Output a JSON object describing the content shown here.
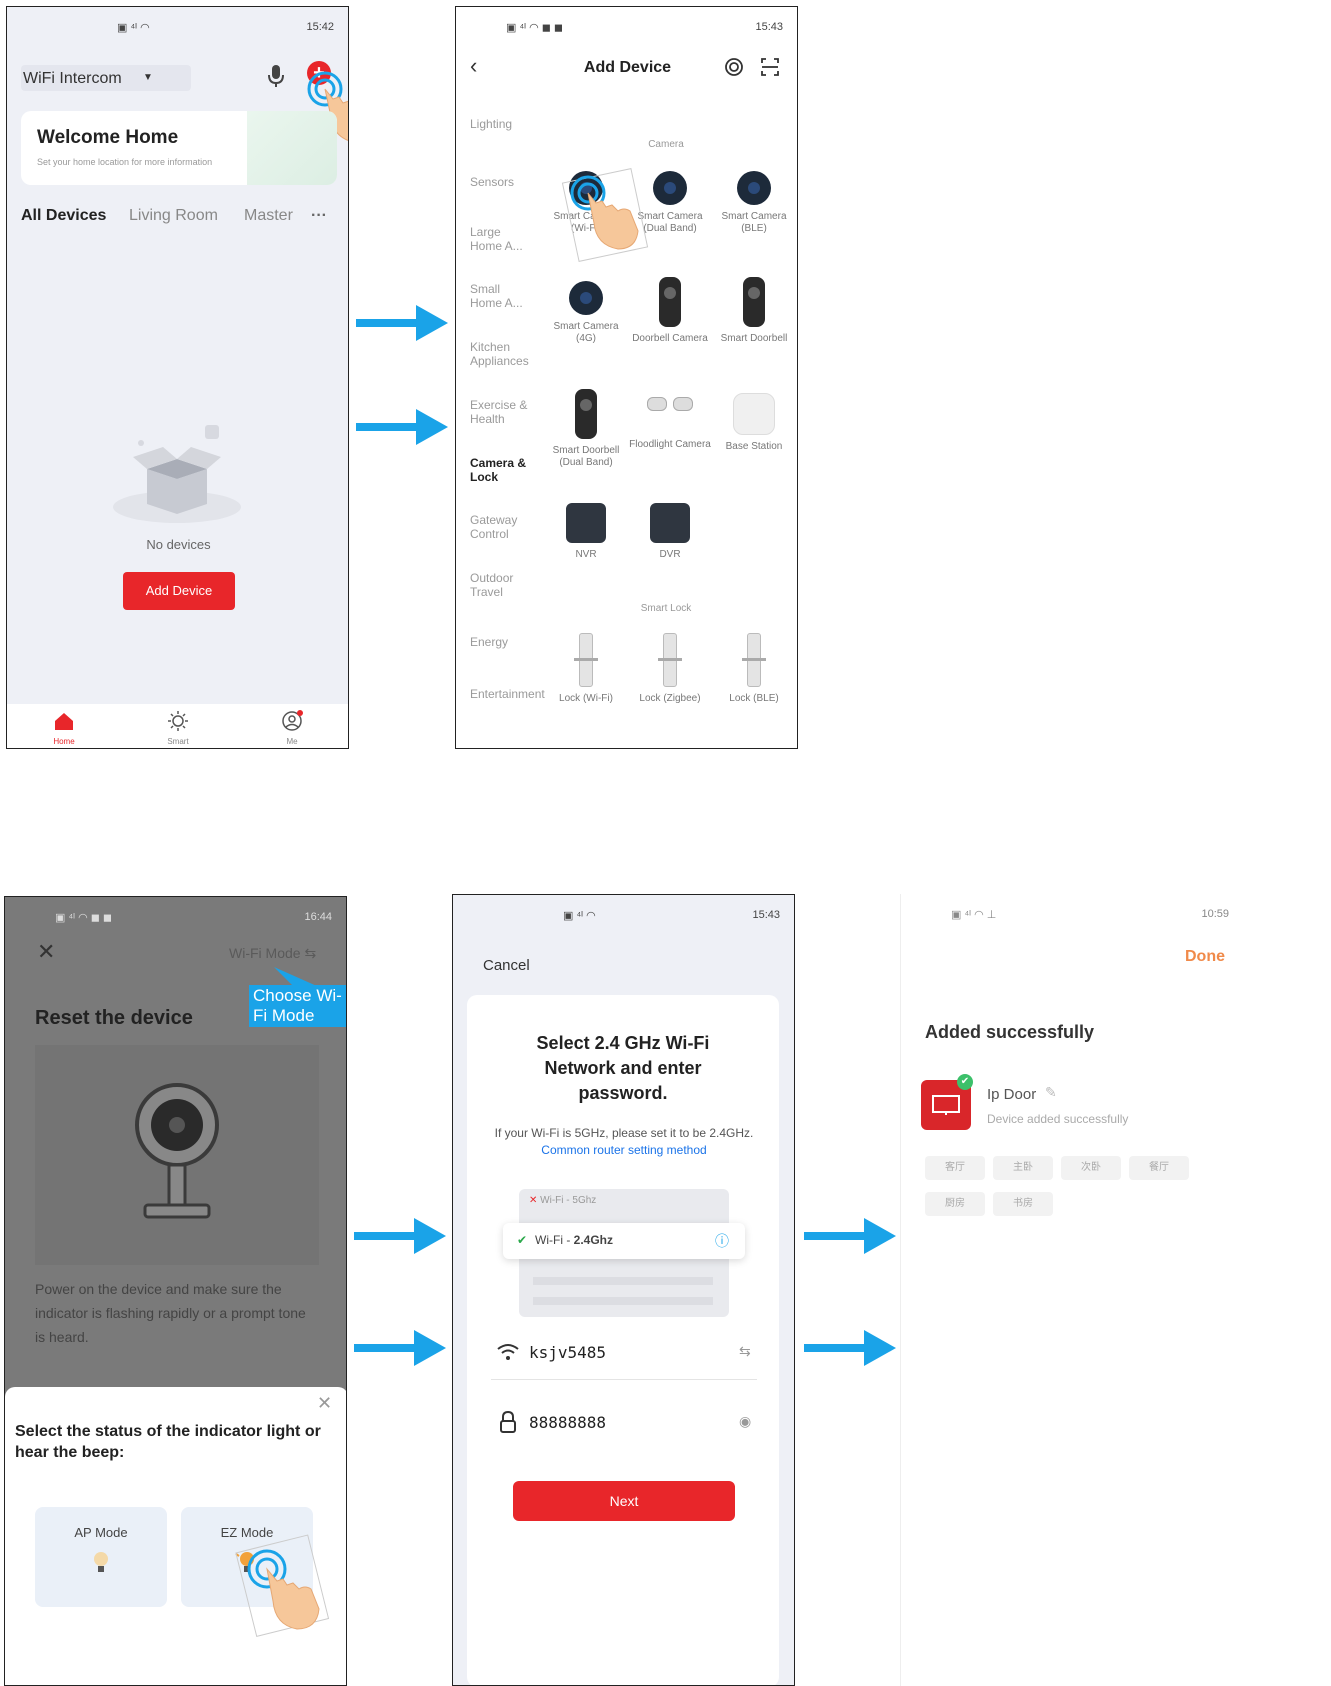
{
  "colors": {
    "accent_red": "#e8262a",
    "arrow_blue": "#1aa3e8",
    "link_blue": "#1a73e8"
  },
  "screen1": {
    "status_right": "15:42",
    "home_name": "WiFi Intercom",
    "welcome_title": "Welcome Home",
    "welcome_subtitle": "Set your home location for more information",
    "tabs": [
      "All Devices",
      "Living Room",
      "Master"
    ],
    "more": "···",
    "empty_text": "No devices",
    "add_button": "Add Device",
    "nav": [
      {
        "label": "Home",
        "icon": "home-icon"
      },
      {
        "label": "Smart",
        "icon": "sun-icon"
      },
      {
        "label": "Me",
        "icon": "profile-icon"
      }
    ]
  },
  "screen2": {
    "status_right": "15:43",
    "title": "Add Device",
    "categories": [
      "Lighting",
      "Sensors",
      "Large Home A...",
      "Small Home A...",
      "Kitchen Appliances",
      "Exercise & Health",
      "Camera & Lock",
      "Gateway Control",
      "Outdoor Travel",
      "Energy",
      "Entertainment"
    ],
    "section_camera": "Camera",
    "section_lock": "Smart Lock",
    "devices": [
      "Smart Camera (Wi-Fi)",
      "Smart Camera (Dual Band)",
      "Smart Camera (BLE)",
      "Smart Camera (4G)",
      "Doorbell Camera",
      "Smart Doorbell",
      "Smart Doorbell (Dual Band)",
      "Floodlight Camera",
      "Base Station",
      "NVR",
      "DVR",
      "Lock (Wi-Fi)",
      "Lock (Zigbee)",
      "Lock (BLE)"
    ]
  },
  "screen3": {
    "status_right": "16:44",
    "wifi_mode": "Wi-Fi Mode",
    "callout": "Choose Wi-Fi Mode",
    "title": "Reset the device",
    "description": "Power on the device and make sure the indicator is flashing rapidly or a prompt tone is heard.",
    "sheet_title": "Select the status of the indicator light or hear the beep:",
    "ap_mode": "AP Mode",
    "ez_mode": "EZ Mode"
  },
  "screen4": {
    "status_right": "15:43",
    "cancel": "Cancel",
    "title": "Select 2.4 GHz Wi-Fi Network and enter password.",
    "hint": "If your Wi-Fi is 5GHz, please set it to be 2.4GHz.",
    "hint_link": "Common router setting method",
    "wifi_5g": "Wi-Fi - 5Ghz",
    "wifi_24_prefix": "Wi-Fi - ",
    "wifi_24_band": "2.4Ghz",
    "ssid": "ksjv5485",
    "password": "88888888",
    "next": "Next"
  },
  "screen5": {
    "status_right": "10:59",
    "done": "Done",
    "title": "Added successfully",
    "device_name": "Ip Door",
    "device_status": "Device added successfully",
    "rooms": [
      "客厅",
      "主卧",
      "次卧",
      "餐厅",
      "厨房",
      "书房"
    ]
  }
}
